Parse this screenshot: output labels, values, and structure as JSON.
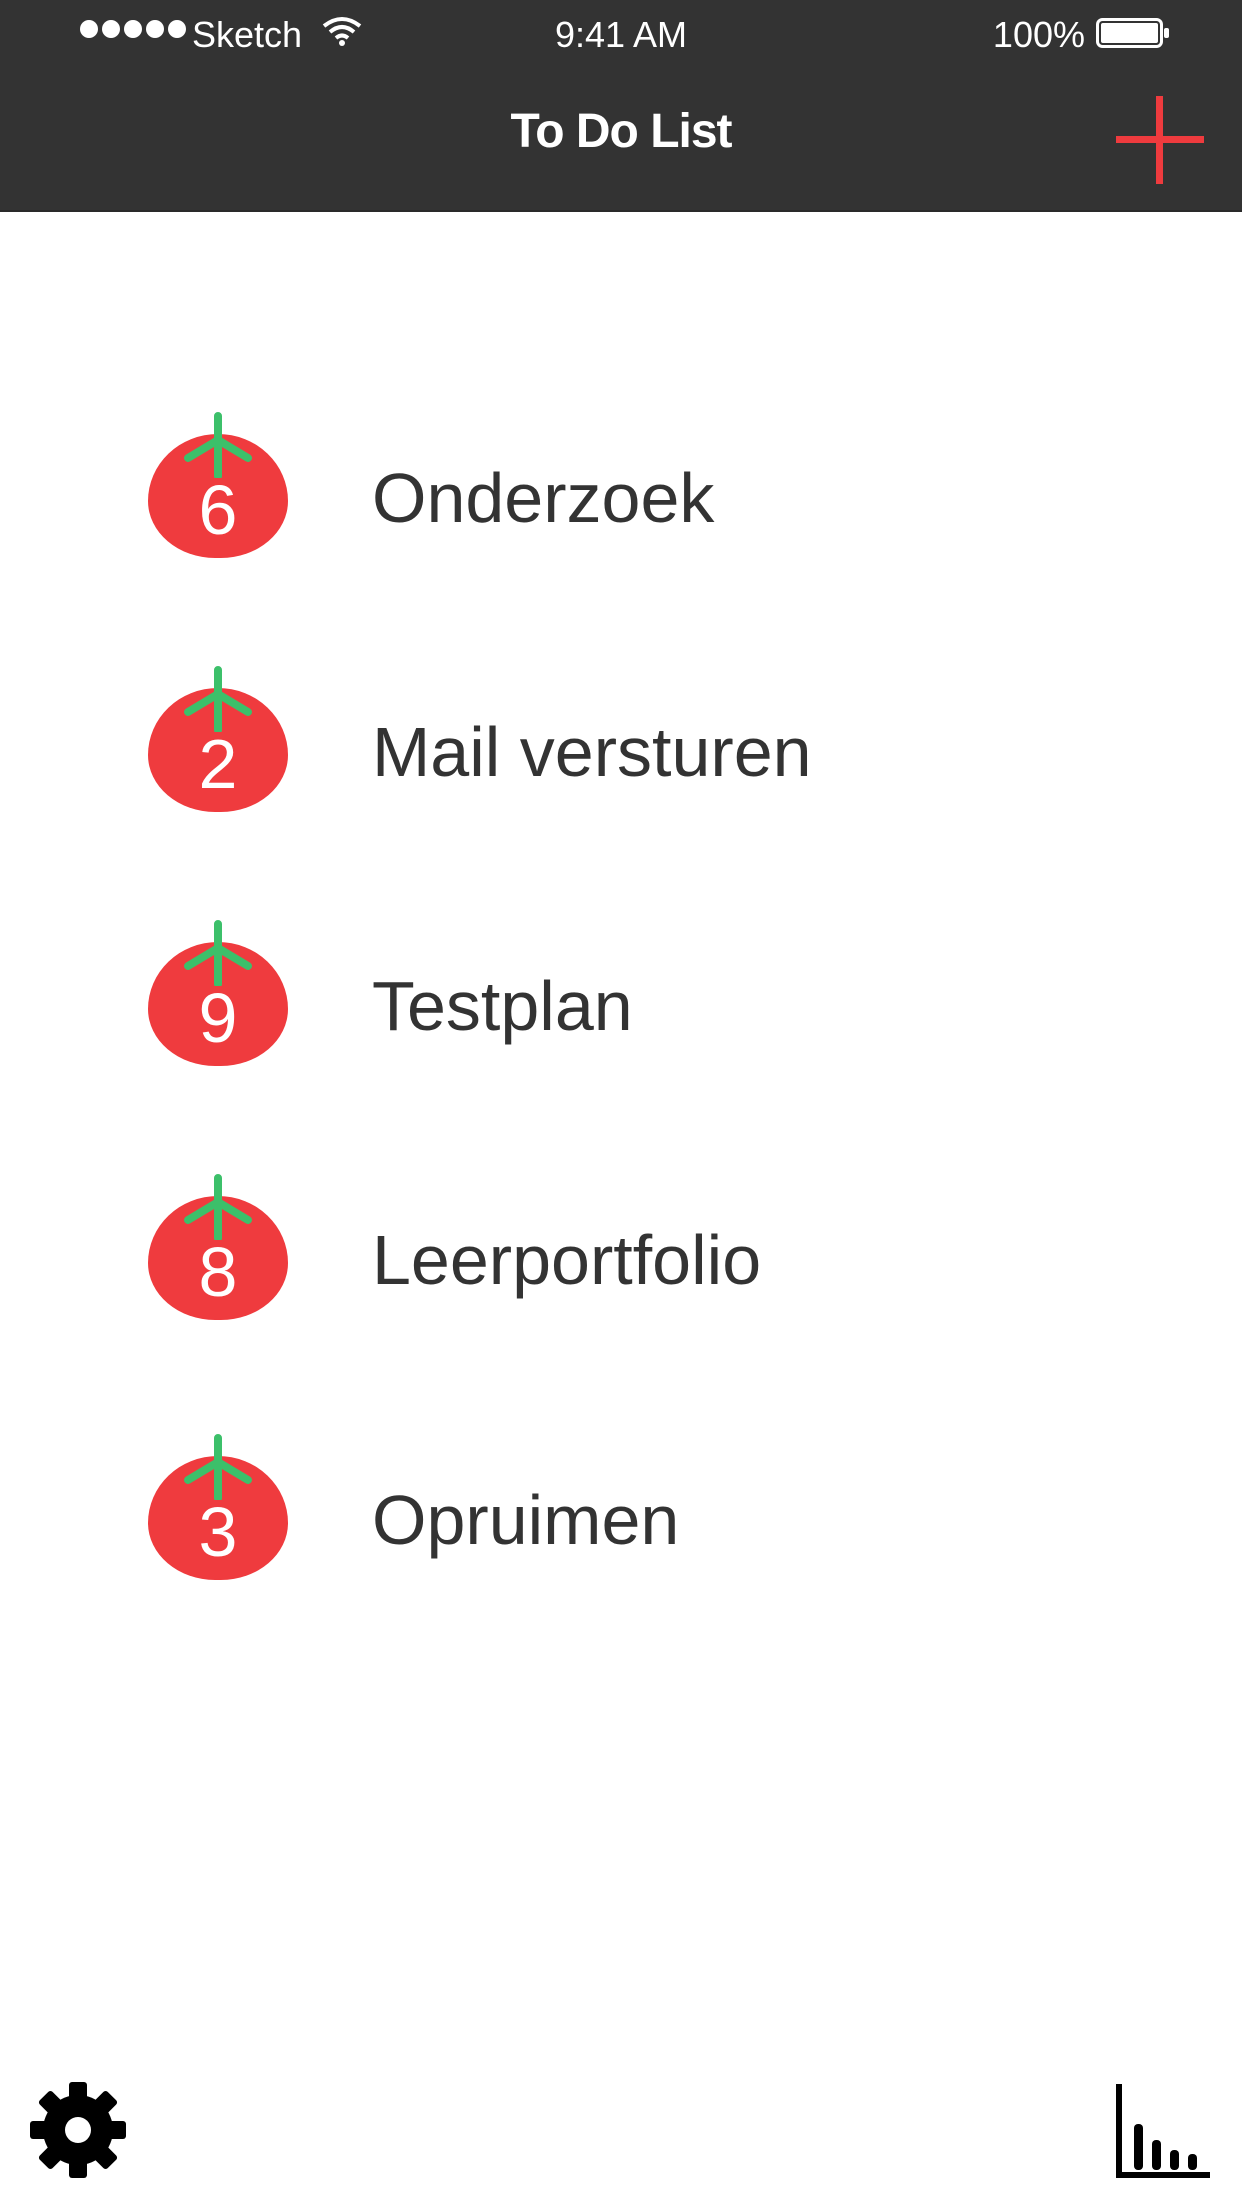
{
  "status_bar": {
    "carrier": "Sketch",
    "time": "9:41 AM",
    "battery": "100%"
  },
  "nav": {
    "title": "To Do List",
    "add_icon": "plus-icon",
    "accent_color": "#ef3b3e",
    "bar_color": "#333333"
  },
  "tasks": [
    {
      "label": "Onderzoek",
      "count": "6"
    },
    {
      "label": "Mail versturen",
      "count": "2"
    },
    {
      "label": "Testplan",
      "count": "9"
    },
    {
      "label": "Leerportfolio",
      "count": "8"
    },
    {
      "label": "Opruimen",
      "count": "3"
    }
  ],
  "toolbar": {
    "settings_icon": "gear-icon",
    "stats_icon": "bar-chart-icon"
  },
  "colors": {
    "tomato": "#ef3b3e",
    "stem": "#3cc06a",
    "text": "#333333"
  }
}
